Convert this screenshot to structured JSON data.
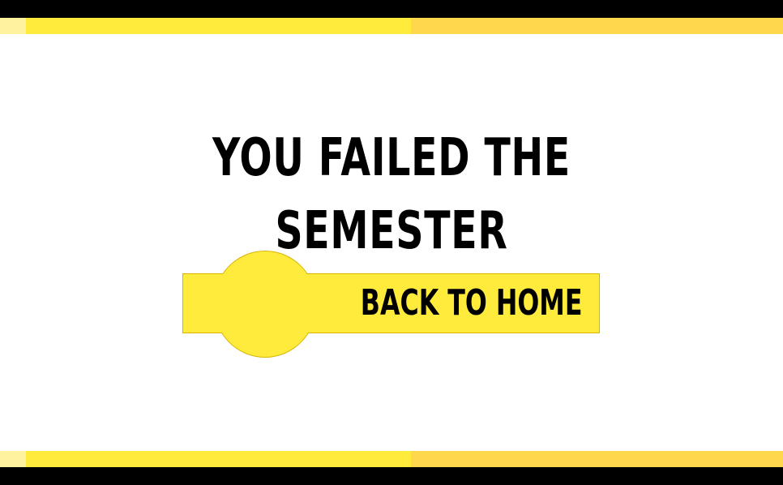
{
  "screen": {
    "title": "YOU FAILED THE SEMESTER",
    "button_label": "BACK TO HOME"
  },
  "colors": {
    "background": "#ffffff",
    "frame_black": "#000000",
    "stripe_light": "#fff3a0",
    "stripe_yellow": "#ffeb3b",
    "stripe_gold": "#ffd84d",
    "button_fill": "#ffeb3b",
    "button_border": "#d9b400",
    "text": "#000000"
  }
}
